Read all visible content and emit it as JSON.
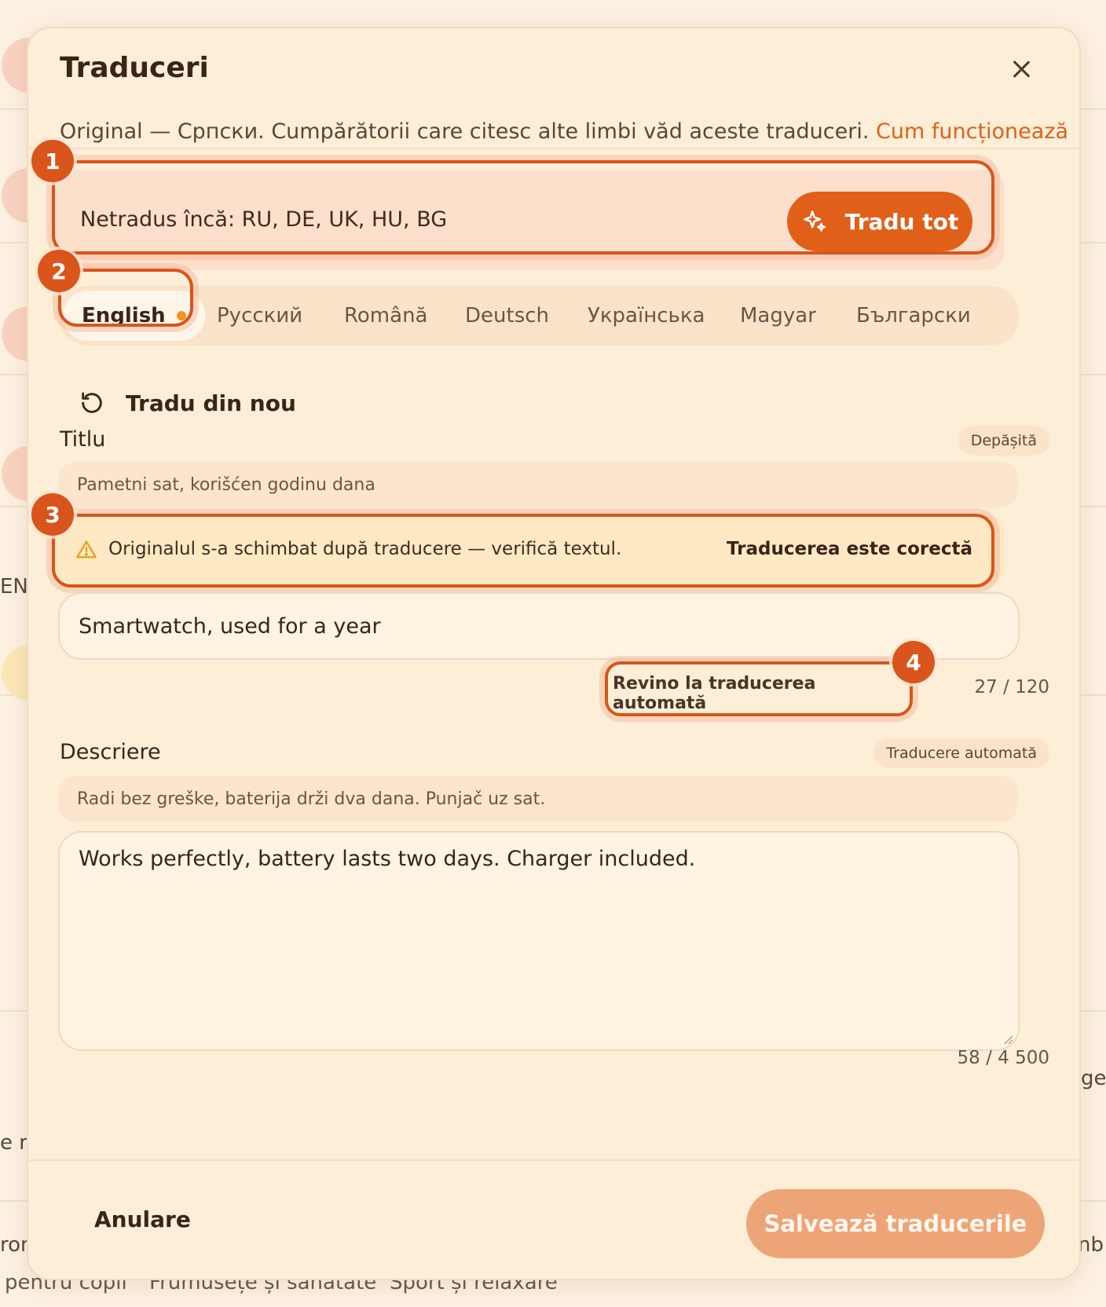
{
  "background": {
    "fragments": [
      "ENT",
      "ge",
      "e r",
      "nb",
      "ron"
    ],
    "categories": [
      "pentru copii",
      "Frumusețe și sănătate",
      "Sport și relaxare"
    ]
  },
  "modal": {
    "title": "Traduceri",
    "subtitle_text": "Original — Српски. Cumpărătorii care citesc alte limbi văd aceste traduceri.",
    "subtitle_link": "Cum funcționează",
    "untranslated_text": "Netradus încă: RU, DE, UK, HU, BG",
    "translate_all_label": "Tradu tot",
    "tabs": [
      {
        "label": "English",
        "active": true,
        "indicator": true
      },
      {
        "label": "Русский"
      },
      {
        "label": "Română"
      },
      {
        "label": "Deutsch"
      },
      {
        "label": "Українська"
      },
      {
        "label": "Magyar"
      },
      {
        "label": "Български"
      }
    ],
    "retranslate_label": "Tradu din nou",
    "title_section": {
      "label": "Titlu",
      "status": "Depășită",
      "original": "Pametni sat, korišćen godinu dana",
      "warning_text": "Originalul s-a schimbat după traducere — verifică textul.",
      "warning_action": "Traducerea este corectă",
      "value": "Smartwatch, used for a year",
      "revert_label": "Revino la traducerea automată",
      "counter": "27 / 120"
    },
    "description_section": {
      "label": "Descriere",
      "status": "Traducere automată",
      "original": "Radi bez greške, baterija drži dva dana. Punjač uz sat.",
      "value": "Works perfectly, battery lasts two days. Charger included.",
      "counter": "58 / 4 500"
    },
    "cancel_label": "Anulare",
    "save_label": "Salvează traducerile"
  },
  "annotations": [
    "1",
    "2",
    "3",
    "4"
  ],
  "colors": {
    "accent": "#e0601a",
    "highlight": "#d9551b",
    "save_disabled": "#eda577",
    "modal_bg": "#fdeed8"
  }
}
